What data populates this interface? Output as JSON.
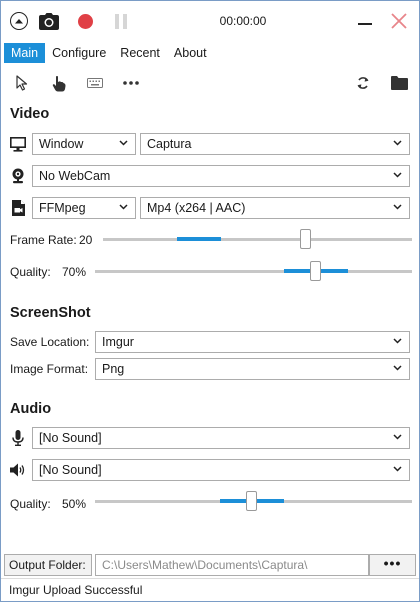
{
  "titlebar": {
    "timer": "00:00:00"
  },
  "tabs": [
    {
      "label": "Main"
    },
    {
      "label": "Configure"
    },
    {
      "label": "Recent"
    },
    {
      "label": "About"
    }
  ],
  "video": {
    "title": "Video",
    "source_type": "Window",
    "source_name": "Captura",
    "webcam": "No WebCam",
    "encoder": "FFMpeg",
    "format": "Mp4 (x264 | AAC)",
    "frame_rate_label": "Frame Rate:",
    "frame_rate_value": "20",
    "frame_rate_fraction": 0.66,
    "quality_label": "Quality:",
    "quality_value": "70%",
    "quality_fraction": 0.7
  },
  "screenshot": {
    "title": "ScreenShot",
    "save_location_label": "Save Location:",
    "save_location": "Imgur",
    "image_format_label": "Image Format:",
    "image_format": "Png"
  },
  "audio": {
    "title": "Audio",
    "microphone": "[No Sound]",
    "speaker": "[No Sound]",
    "quality_label": "Quality:",
    "quality_value": "50%",
    "quality_fraction": 0.5
  },
  "output": {
    "label": "Output Folder:",
    "path": "C:\\Users\\Mathew\\Documents\\Captura\\",
    "browse_label": "•••"
  },
  "status": {
    "text": "Imgur Upload Successful"
  },
  "colors": {
    "accent": "#1c8fd8",
    "record": "#e04046",
    "close": "#e8858a"
  },
  "icons": [
    "collapse-icon",
    "camera-icon",
    "record-icon",
    "pause-icon",
    "minimize-icon",
    "close-icon",
    "cursor-icon",
    "hand-icon",
    "keyboard-icon",
    "more-icon",
    "refresh-icon",
    "folder-icon",
    "monitor-icon",
    "webcam-icon",
    "video-file-icon",
    "microphone-icon",
    "speaker-icon",
    "chevron-down-icon"
  ]
}
